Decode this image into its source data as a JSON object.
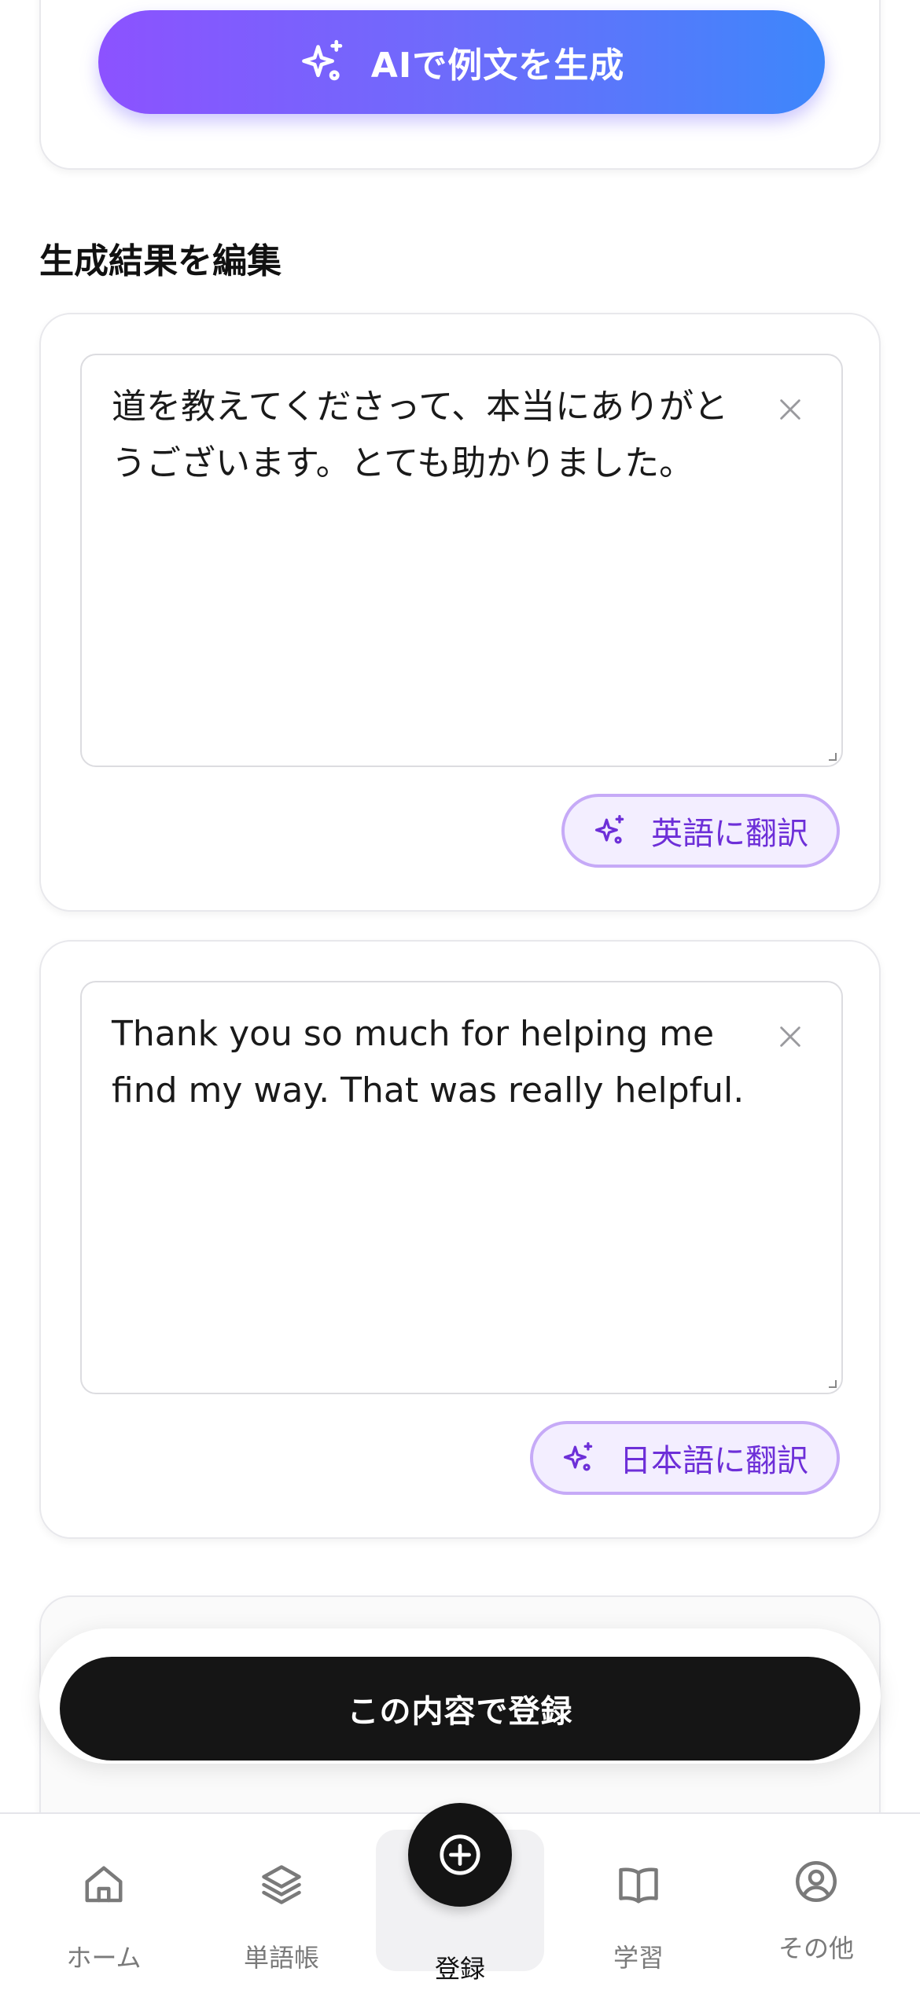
{
  "generate": {
    "label": "AIで例文を生成",
    "icon": "sparkles-icon"
  },
  "section": {
    "title": "生成結果を編集"
  },
  "japanese_card": {
    "text": "道を教えてくださって、本当にありがとうございます。とても助かりました。",
    "translate_label": "英語に翻訳",
    "clear_icon": "close-icon"
  },
  "english_card": {
    "text": "Thank you so much for helping me find my way. That was really helpful.",
    "translate_label": "日本語に翻訳",
    "clear_icon": "close-icon"
  },
  "submit": {
    "label": "この内容で登録"
  },
  "tabbar": {
    "items": [
      {
        "label": "ホーム",
        "icon": "home-icon"
      },
      {
        "label": "単語帳",
        "icon": "layers-icon"
      },
      {
        "label": "登録",
        "icon": "plus-circle-icon",
        "active": true
      },
      {
        "label": "学習",
        "icon": "book-open-icon"
      },
      {
        "label": "その他",
        "icon": "user-circle-icon"
      }
    ]
  },
  "colors": {
    "gradient_start": "#8c52ff",
    "gradient_end": "#3d87fb",
    "accent_purple": "#6d2fd8",
    "dark_button": "#151515"
  }
}
